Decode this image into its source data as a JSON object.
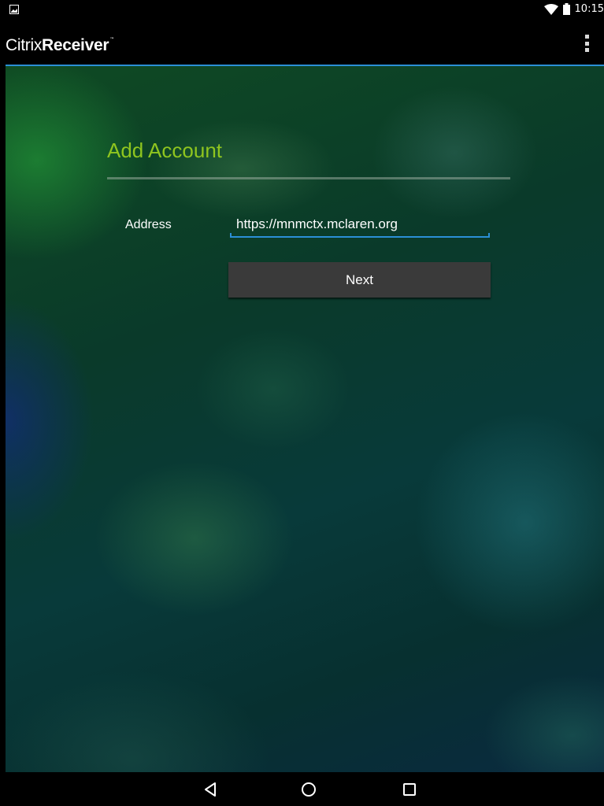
{
  "status_bar": {
    "time": "10:15",
    "icons": [
      "notification-icon",
      "wifi-icon",
      "battery-icon"
    ]
  },
  "app_bar": {
    "brand_light": "Citrix",
    "brand_bold": "Receiver",
    "brand_tm": "™",
    "menu_icon": "overflow-menu-icon"
  },
  "form": {
    "title": "Add Account",
    "address_label": "Address",
    "address_value": "https://mnmctx.mclaren.org",
    "next_label": "Next"
  },
  "nav_bar": {
    "icons": [
      "back-icon",
      "home-icon",
      "recents-icon"
    ]
  },
  "colors": {
    "accent": "#2b8fd6",
    "title_green": "#8fc51f",
    "button_bg": "#3a3a3a"
  }
}
